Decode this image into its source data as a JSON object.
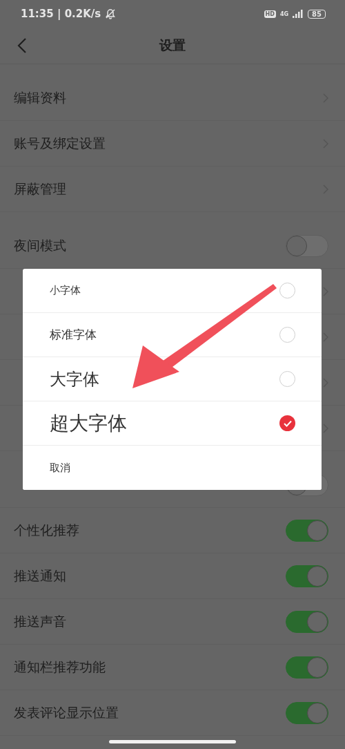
{
  "status_bar": {
    "time": "11:35 | 0.2K/s",
    "hd": "HD",
    "network": "4G",
    "battery": "85"
  },
  "header": {
    "title": "设置"
  },
  "groups": [
    {
      "items": [
        {
          "label": "编辑资料",
          "kind": "link"
        },
        {
          "label": "账号及绑定设置",
          "kind": "link"
        },
        {
          "label": "屏蔽管理",
          "kind": "link"
        }
      ]
    },
    {
      "items": [
        {
          "label": "夜间模式",
          "kind": "toggle",
          "on": false
        },
        {
          "kind": "link"
        },
        {
          "kind": "link"
        },
        {
          "kind": "link"
        },
        {
          "kind": "link"
        }
      ]
    },
    {
      "items": [
        {
          "kind": "toggle",
          "on": false
        },
        {
          "label": "个性化推荐",
          "kind": "toggle",
          "on": true
        },
        {
          "label": "推送通知",
          "kind": "toggle",
          "on": true
        },
        {
          "label": "推送声音",
          "kind": "toggle",
          "on": true
        },
        {
          "label": "通知栏推荐功能",
          "kind": "toggle",
          "on": true
        },
        {
          "label": "发表评论显示位置",
          "kind": "toggle",
          "on": true
        }
      ]
    }
  ],
  "dialog": {
    "options": [
      {
        "label": "小字体",
        "selected": false
      },
      {
        "label": "标准字体",
        "selected": false
      },
      {
        "label": "大字体",
        "selected": false
      },
      {
        "label": "超大字体",
        "selected": true
      }
    ],
    "cancel": "取消"
  }
}
